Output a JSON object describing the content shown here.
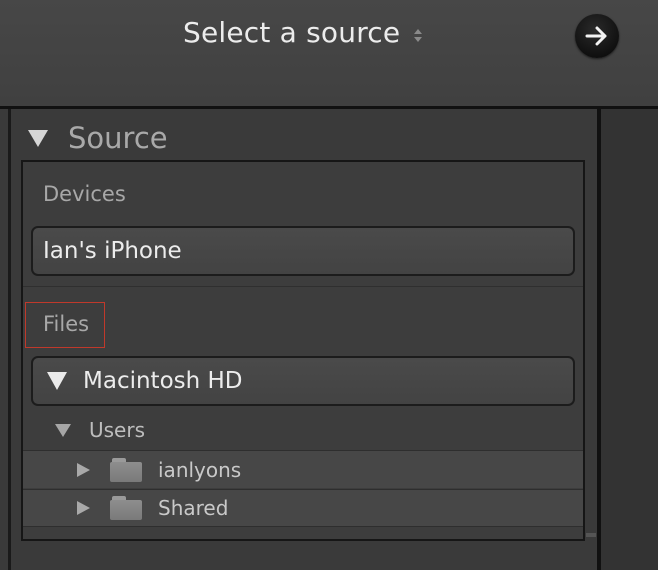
{
  "header": {
    "title": "Select a source",
    "title_dropdown_icon": "updown-chevron-icon",
    "next_icon": "arrow-right-icon"
  },
  "panel": {
    "section_title": "Source",
    "section_icon": "disclosure-triangle-down-icon",
    "devices": {
      "label": "Devices",
      "items": [
        {
          "label": "Ian's iPhone"
        }
      ]
    },
    "files": {
      "label": "Files",
      "volume": {
        "label": "Macintosh HD",
        "icon": "disclosure-triangle-down-icon"
      },
      "tree": {
        "folder": {
          "label": "Users",
          "icon": "disclosure-triangle-down-icon"
        },
        "children": [
          {
            "label": "ianlyons",
            "icon": "folder-icon"
          },
          {
            "label": "Shared",
            "icon": "folder-icon"
          }
        ]
      }
    }
  },
  "colors": {
    "background": "#3a3a3a",
    "highlight_outline": "#c0392b",
    "text_primary": "#ececec",
    "text_secondary": "#a8a8a8"
  }
}
